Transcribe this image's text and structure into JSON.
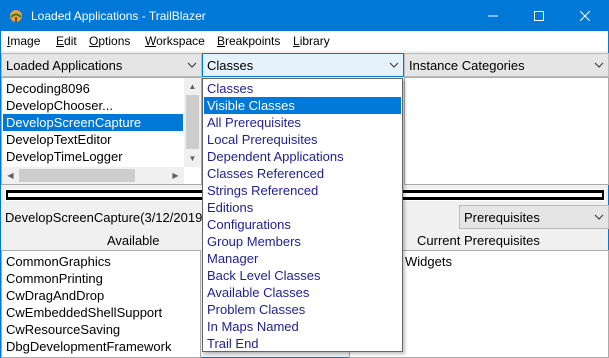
{
  "window": {
    "title": "Loaded Applications - TrailBlazer",
    "controls": {
      "minimize": "—",
      "maximize": "☐",
      "close": "✕"
    }
  },
  "menubar": {
    "items": [
      {
        "label": "Image",
        "mnemonic": "I",
        "rest": "mage"
      },
      {
        "label": "Edit",
        "mnemonic": "E",
        "rest": "dit"
      },
      {
        "label": "Options",
        "mnemonic": "O",
        "rest": "ptions"
      },
      {
        "label": "Workspace",
        "mnemonic": "W",
        "rest": "orkspace"
      },
      {
        "label": "Breakpoints",
        "mnemonic": "B",
        "rest": "reakpoints"
      },
      {
        "label": "Library",
        "mnemonic": "L",
        "rest": "ibrary"
      }
    ]
  },
  "combos": {
    "left": "Loaded Applications",
    "middle": "Classes",
    "right": "Instance Categories",
    "prereq": "Prerequisites"
  },
  "top_list": {
    "items": [
      "Decoding8096",
      "DevelopChooser...",
      "DevelopScreenCapture",
      "DevelopTextEditor",
      "DevelopTimeLogger"
    ],
    "selected_index": 2
  },
  "status": {
    "text": "DevelopScreenCapture(3/12/2019"
  },
  "headers": {
    "available": "Available",
    "current": "Current Prerequisites"
  },
  "available_list": {
    "items": [
      "CommonGraphics",
      "CommonPrinting",
      "CwDragAndDrop",
      "CwEmbeddedShellSupport",
      "CwResourceSaving",
      "DbgDevelopmentFramework"
    ]
  },
  "current_list": {
    "partial_item": "Widgets"
  },
  "dropdown": {
    "items": [
      "Classes",
      "Visible Classes",
      "All Prerequisites",
      "Local Prerequisites",
      "Dependent Applications",
      "Classes Referenced",
      "Strings Referenced",
      "Editions",
      "Configurations",
      "Group Members",
      "Manager",
      "Back Level Classes",
      "Available Classes",
      "Problem Classes",
      "In Maps Named",
      "Trail End"
    ],
    "highlighted_index": 1
  },
  "colors": {
    "accent": "#0078d7",
    "dropdown_text": "#1f1f8f"
  },
  "icons": {
    "app": "trailblazer-app-icon",
    "combo_arrow": "chevron-down-icon"
  }
}
